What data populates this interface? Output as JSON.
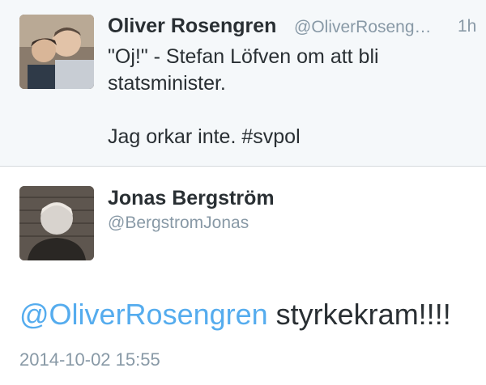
{
  "tweet1": {
    "name": "Oliver Rosengren",
    "handle": "@OliverRoseng…",
    "time": "1h",
    "text_lines": [
      "\"Oj!\" - Stefan Löfven om att bli",
      "statsminister.",
      "",
      "Jag orkar inte. #svpol"
    ]
  },
  "tweet2": {
    "name": "Jonas Bergström",
    "handle": "@BergstromJonas",
    "mention": "@OliverRosengren",
    "body": " styrkekram!!!!",
    "date": "2014-10-02 15:55"
  },
  "colors": {
    "mention": "#55acee",
    "muted": "#8899a6",
    "text": "#292f33",
    "tweet_bg": "#f5f8fa"
  },
  "icons": [
    "avatar-photo",
    "avatar-photo"
  ]
}
